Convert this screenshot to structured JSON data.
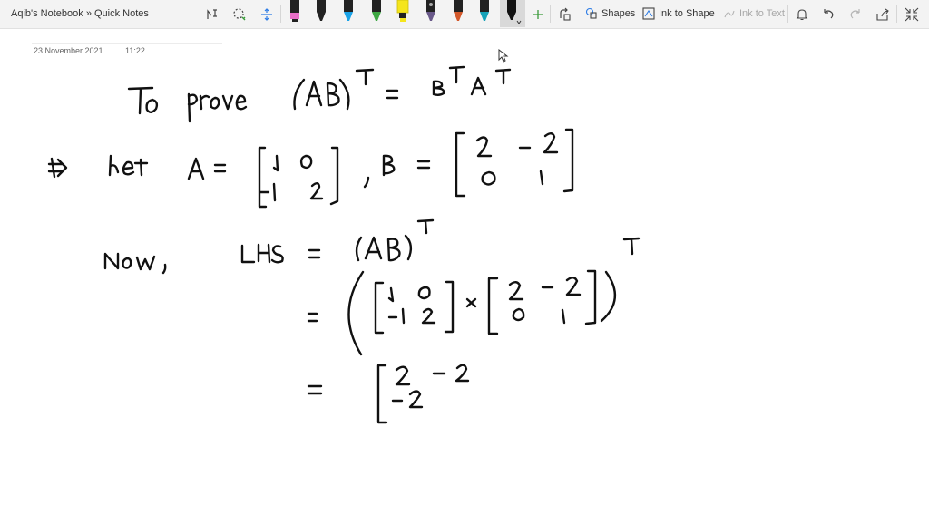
{
  "breadcrumb": "Aqib's Notebook » Quick Notes",
  "toolbar": {
    "shapes_label": "Shapes",
    "ink_to_shape_label": "Ink to Shape",
    "ink_to_text_label": "Ink to Text"
  },
  "pens": [
    {
      "name": "pen-black-pink",
      "color": "#222222",
      "tip": "#e96fc8"
    },
    {
      "name": "pen-black",
      "color": "#222222",
      "tip": "#111111"
    },
    {
      "name": "pen-cyan",
      "color": "#1aa3e8",
      "tip": "#1aa3e8"
    },
    {
      "name": "pen-green",
      "color": "#3ea843",
      "tip": "#3ea843"
    },
    {
      "name": "highlighter-yellow",
      "color": "#f5e51c",
      "tip": "#f5e51c"
    },
    {
      "name": "pen-galaxy",
      "color": "#6a5a8a",
      "tip": "#6a5a8a"
    },
    {
      "name": "pen-multicolor",
      "color": "#d3582a",
      "tip": "#d3582a"
    },
    {
      "name": "pen-teal",
      "color": "#17a2b8",
      "tip": "#17a2b8"
    },
    {
      "name": "pen-black-selected",
      "color": "#111111",
      "tip": "#111111"
    }
  ],
  "page": {
    "date": "23 November 2021",
    "time": "11:22"
  },
  "handwriting": {
    "line1": "To prove (AB)^T = B^T A^T",
    "line2": "=> Let A = [1 0; -1 2], B = [2 -2; 0 1]",
    "line3": "Now, LHS = (AB)^T",
    "line4": "= ([1 0; -1 2] x [2 -2; 0 1])^T",
    "line5": "= [2 -2; -2"
  }
}
